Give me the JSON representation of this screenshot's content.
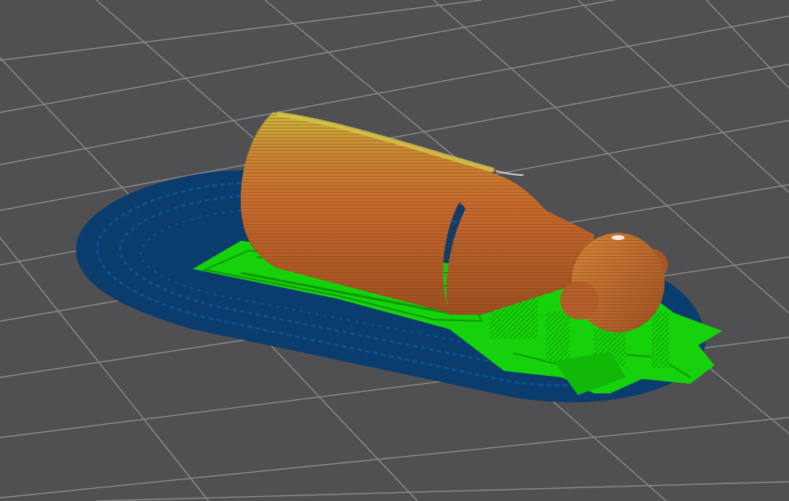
{
  "viewport": {
    "background_color": "#505052",
    "grid_line_color": "#8a8a8c",
    "grid_visible": true
  },
  "model": {
    "bottle_body_color": "#c86a2e",
    "bottle_highlight_color": "#c9b83a",
    "bottle_shadow_color": "#9c4f20",
    "support_color": "#16d20a",
    "support_dark_color": "#0e9a06",
    "brim_color": "#0a3c6e",
    "brim_inner_color": "#0b5290"
  },
  "icons": {
    "model": "bottle-model-icon"
  }
}
